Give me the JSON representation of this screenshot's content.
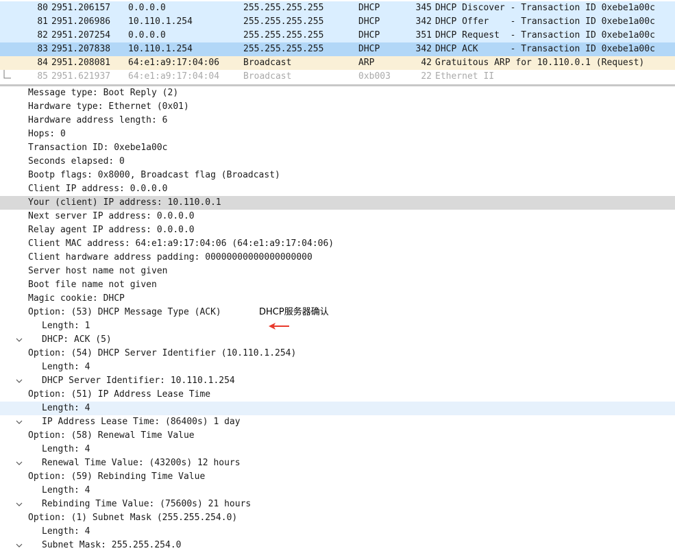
{
  "colors": {
    "dhcp_row_bg": "#daeeff",
    "selected_packet_bg": "#b2d7f7",
    "arp_row_bg": "#faf0d7",
    "dim_text": "#aaaaaa",
    "selected_detail_bg": "#d9d9d9",
    "hover_detail_bg": "#e6f1fc",
    "annotation_arrow": "#e8392c"
  },
  "packets": [
    {
      "no": "80",
      "time": "2951.206157",
      "src": "0.0.0.0",
      "dst": "255.255.255.255",
      "proto": "DHCP",
      "len": "345",
      "info": "DHCP Discover - Transaction ID 0xebe1a00c"
    },
    {
      "no": "81",
      "time": "2951.206986",
      "src": "10.110.1.254",
      "dst": "255.255.255.255",
      "proto": "DHCP",
      "len": "342",
      "info": "DHCP Offer    - Transaction ID 0xebe1a00c"
    },
    {
      "no": "82",
      "time": "2951.207254",
      "src": "0.0.0.0",
      "dst": "255.255.255.255",
      "proto": "DHCP",
      "len": "351",
      "info": "DHCP Request  - Transaction ID 0xebe1a00c"
    },
    {
      "no": "83",
      "time": "2951.207838",
      "src": "10.110.1.254",
      "dst": "255.255.255.255",
      "proto": "DHCP",
      "len": "342",
      "info": "DHCP ACK      - Transaction ID 0xebe1a00c"
    },
    {
      "no": "84",
      "time": "2951.208081",
      "src": "64:e1:a9:17:04:06",
      "dst": "Broadcast",
      "proto": "ARP",
      "len": "42",
      "info": "Gratuitous ARP for 10.110.0.1 (Request)"
    },
    {
      "no": "85",
      "time": "2951.621937",
      "src": "64:e1:a9:17:04:04",
      "dst": "Broadcast",
      "proto": "0xb003",
      "len": "22",
      "info": "Ethernet II"
    }
  ],
  "details": [
    {
      "text": "Message type: Boot Reply (2)"
    },
    {
      "text": "Hardware type: Ethernet (0x01)"
    },
    {
      "text": "Hardware address length: 6"
    },
    {
      "text": "Hops: 0"
    },
    {
      "text": "Transaction ID: 0xebe1a00c"
    },
    {
      "text": "Seconds elapsed: 0"
    },
    {
      "text": "Bootp flags: 0x8000, Broadcast flag (Broadcast)"
    },
    {
      "text": "Client IP address: 0.0.0.0"
    },
    {
      "text": "Your (client) IP address: 10.110.0.1"
    },
    {
      "text": "Next server IP address: 0.0.0.0"
    },
    {
      "text": "Relay agent IP address: 0.0.0.0"
    },
    {
      "text": "Client MAC address: 64:e1:a9:17:04:06 (64:e1:a9:17:04:06)"
    },
    {
      "text": "Client hardware address padding: 00000000000000000000"
    },
    {
      "text": "Server host name not given"
    },
    {
      "text": "Boot file name not given"
    },
    {
      "text": "Magic cookie: DHCP"
    },
    {
      "text": "Option: (53) DHCP Message Type (ACK)"
    },
    {
      "text": "Length: 1"
    },
    {
      "text": "DHCP: ACK (5)"
    },
    {
      "text": "Option: (54) DHCP Server Identifier (10.110.1.254)"
    },
    {
      "text": "Length: 4"
    },
    {
      "text": "DHCP Server Identifier: 10.110.1.254"
    },
    {
      "text": "Option: (51) IP Address Lease Time"
    },
    {
      "text": "Length: 4"
    },
    {
      "text": "IP Address Lease Time: (86400s) 1 day"
    },
    {
      "text": "Option: (58) Renewal Time Value"
    },
    {
      "text": "Length: 4"
    },
    {
      "text": "Renewal Time Value: (43200s) 12 hours"
    },
    {
      "text": "Option: (59) Rebinding Time Value"
    },
    {
      "text": "Length: 4"
    },
    {
      "text": "Rebinding Time Value: (75600s) 21 hours"
    },
    {
      "text": "Option: (1) Subnet Mask (255.255.254.0)"
    },
    {
      "text": "Length: 4"
    },
    {
      "text": "Subnet Mask: 255.255.254.0"
    }
  ],
  "annotation": {
    "label": "DHCP服务器确认"
  }
}
